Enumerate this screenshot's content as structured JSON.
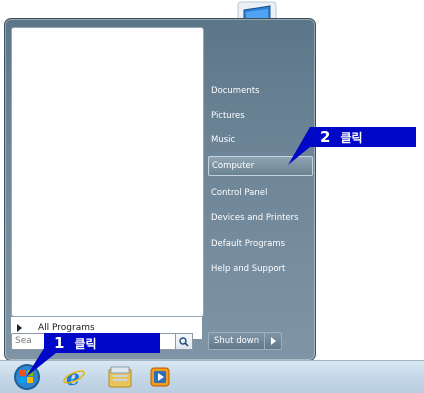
{
  "start_menu": {
    "all_programs_label": "All Programs",
    "search_placeholder": "Sea",
    "right_items": [
      {
        "label": "Documents"
      },
      {
        "label": "Pictures"
      },
      {
        "label": "Music"
      },
      {
        "label": "Computer"
      },
      {
        "label": "Control Panel"
      },
      {
        "label": "Devices and Printers"
      },
      {
        "label": "Default Programs"
      },
      {
        "label": "Help and Support"
      }
    ],
    "shutdown_label": "Shut down"
  },
  "callouts": {
    "step1": {
      "number": "1",
      "text": "클릭"
    },
    "step2": {
      "number": "2",
      "text": "클릭"
    }
  },
  "taskbar": {
    "icons": [
      "start-orb-icon",
      "internet-explorer-icon",
      "windows-explorer-icon",
      "media-player-icon"
    ]
  },
  "colors": {
    "callout_bg": "#0008c8",
    "menu_bg": "#6d8597"
  }
}
